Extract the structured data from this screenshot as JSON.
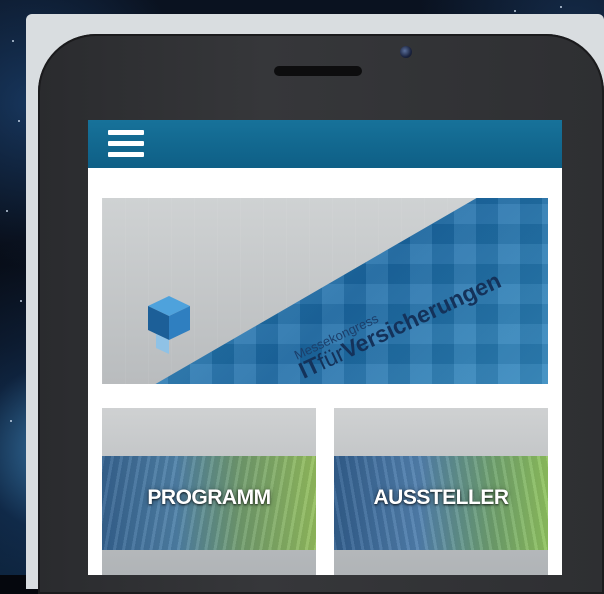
{
  "banner": {
    "line1": "Messekongress",
    "brand_it": "IT",
    "brand_fuer": "für",
    "brand_rest": "Versicherungen"
  },
  "header": {
    "menu_icon": "hamburger-menu-icon",
    "color": "#14729a"
  },
  "tiles": [
    {
      "label": "PROGRAMM"
    },
    {
      "label": "AUSSTELLER"
    }
  ],
  "colors": {
    "brand_dark": "#14325a",
    "banner_blue": "#2f86bd",
    "header_blue": "#0e5f86"
  }
}
